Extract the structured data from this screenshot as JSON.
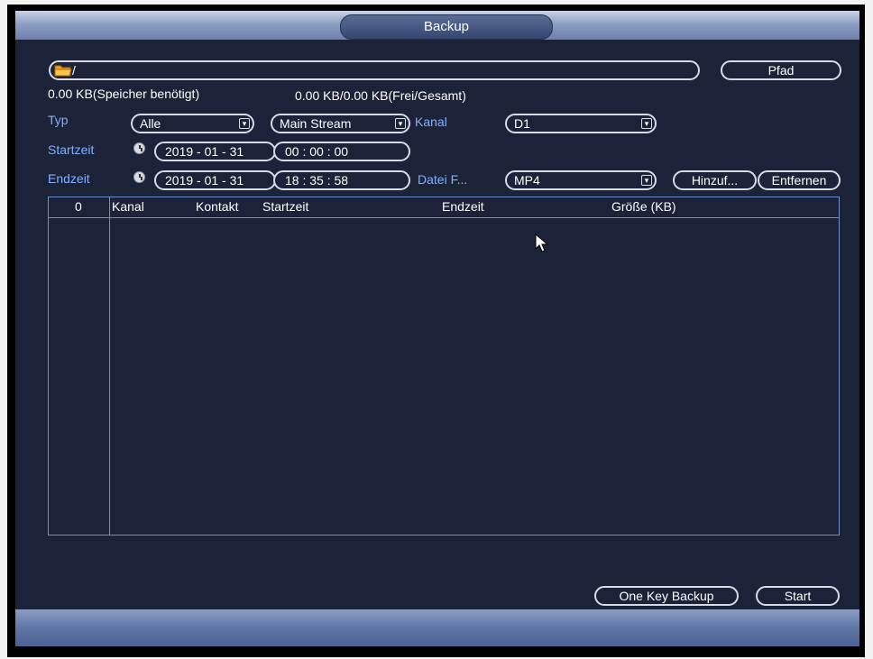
{
  "window": {
    "title": "Backup"
  },
  "path": {
    "value": "/",
    "button_label": "Pfad"
  },
  "storage": {
    "required": "0.00 KB(Speicher benötigt)",
    "free_total": "0.00 KB/0.00 KB(Frei/Gesamt)"
  },
  "filters": {
    "type_label": "Typ",
    "type_value": "Alle",
    "stream_value": "Main Stream",
    "channel_label": "Kanal",
    "channel_value": "D1",
    "start_label": "Startzeit",
    "start_date": "2019 - 01 - 31",
    "start_time": "00 : 00 : 00",
    "end_label": "Endzeit",
    "end_date": "2019 - 01 - 31",
    "end_time": "18 : 35 : 58",
    "format_label": "Datei F...",
    "format_value": "MP4",
    "add_label": "Hinzuf...",
    "remove_label": "Entfernen"
  },
  "table": {
    "count": "0",
    "columns": [
      "Kanal",
      "Kontakt",
      "Startzeit",
      "Endzeit",
      "Größe (KB)"
    ]
  },
  "footer": {
    "one_key_label": "One Key Backup",
    "start_label": "Start"
  },
  "icons": {
    "folder": "folder-icon",
    "clock": "clock-icon",
    "dropdown": "chevron-down-icon",
    "cursor": "mouse-pointer-icon"
  },
  "colors": {
    "background": "#1c2339",
    "label_blue": "#7fb0ff",
    "border": "#d7dbe6",
    "table_border": "#6c8fd0"
  }
}
